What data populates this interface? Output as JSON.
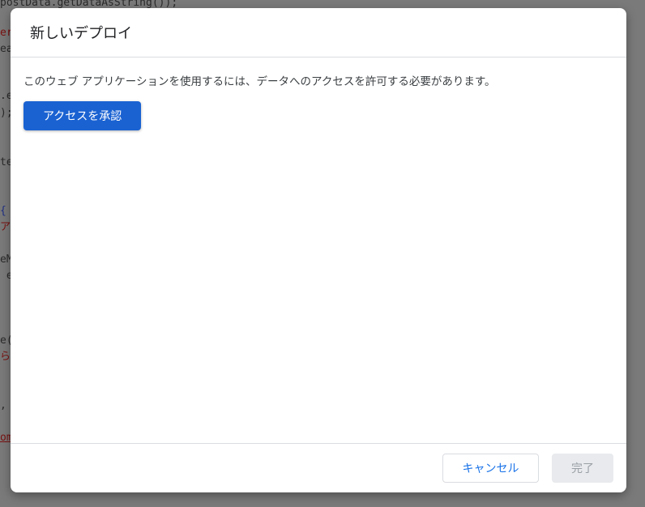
{
  "background_code": [
    "postData.getDataAsString());",
    "er",
    "ea",
    ".e",
    ");",
    "te",
    "{",
    "ア",
    "eM",
    " e",
    "e(",
    "ら!",
    ",",
    "om"
  ],
  "dialog": {
    "title": "新しいデプロイ",
    "message": "このウェブ アプリケーションを使用するには、データへのアクセスを許可する必要があります。",
    "authorize_label": "アクセスを承認",
    "cancel_label": "キャンセル",
    "done_label": "完了"
  },
  "colors": {
    "primary": "#1a62d2",
    "link": "#1a73e8",
    "disabled_bg": "#e8eaed"
  }
}
